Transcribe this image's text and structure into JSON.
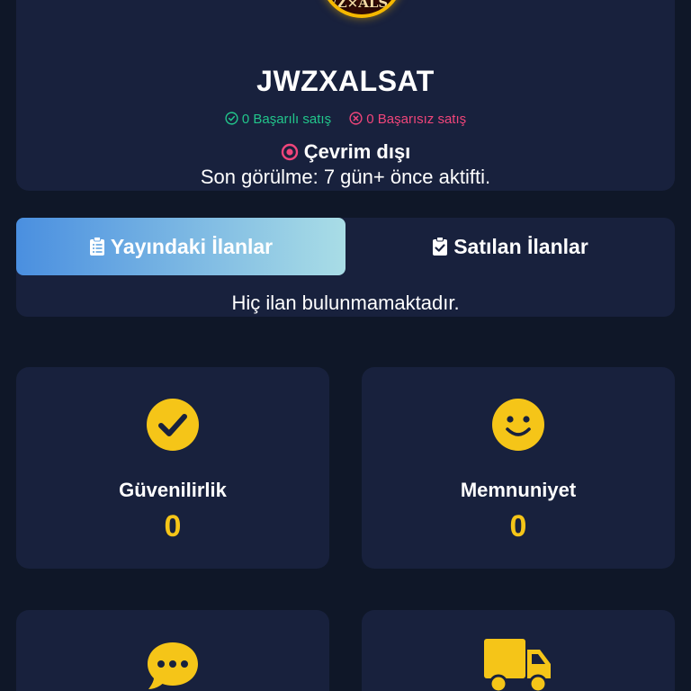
{
  "profile": {
    "avatar_text": "JWZ×ALSAT",
    "username": "JWZXALSAT",
    "successful_sales": "0 Başarılı satış",
    "failed_sales": "0 Başarısız satış",
    "status": "Çevrim dışı",
    "last_seen": "Son görülme: 7 gün+ önce aktifti."
  },
  "tabs": {
    "active_label": "Yayındaki İlanlar",
    "inactive_label": "Satılan İlanlar",
    "empty_message": "Hiç ilan bulunmamaktadır."
  },
  "metrics": [
    {
      "label": "Güvenilirlik",
      "value": "0",
      "icon": "check-circle-icon"
    },
    {
      "label": "Memnuniyet",
      "value": "0",
      "icon": "smile-icon"
    },
    {
      "label": "",
      "value": "",
      "icon": "comment-dots-icon"
    },
    {
      "label": "",
      "value": "",
      "icon": "truck-icon"
    }
  ],
  "colors": {
    "background": "#0f1728",
    "card": "#18213d",
    "accent_yellow": "#f5c518",
    "success_green": "#22c58b",
    "fail_pink": "#f0457a"
  }
}
